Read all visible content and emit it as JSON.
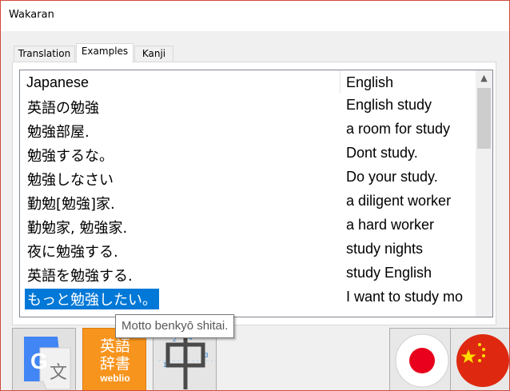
{
  "window": {
    "title": "Wakaran"
  },
  "tabs": [
    {
      "label": "Translation",
      "active": false
    },
    {
      "label": "Examples",
      "active": true
    },
    {
      "label": "Kanji",
      "active": false
    }
  ],
  "list": {
    "columns": [
      "Japanese",
      "English"
    ],
    "rows": [
      {
        "jp": "英語の勉強",
        "en": "English study"
      },
      {
        "jp": "勉強部屋.",
        "en": "a room for study"
      },
      {
        "jp": "勉強するな。",
        "en": "Dont study."
      },
      {
        "jp": "勉強しなさい",
        "en": "Do your study."
      },
      {
        "jp": "勤勉[勉強]家.",
        "en": "a diligent worker"
      },
      {
        "jp": "勤勉家, 勉強家.",
        "en": "a hard worker"
      },
      {
        "jp": "夜に勉強する.",
        "en": "study nights"
      },
      {
        "jp": "英語を勉強する.",
        "en": "study English"
      },
      {
        "jp": "もっと勉強したい。",
        "en": "I want to study mo",
        "selected": true
      }
    ]
  },
  "tooltip": {
    "text": "Motto benkyō shitai."
  },
  "buttons": {
    "weblio": {
      "line1": "英語",
      "line2": "辞書",
      "brand": "weblio"
    }
  },
  "colors": {
    "selection": "#0078d7",
    "google_blue": "#4285f4",
    "weblio_orange": "#f7941d",
    "japan_red": "#e8001c",
    "china_red": "#de2910",
    "china_yellow": "#ffde00"
  }
}
